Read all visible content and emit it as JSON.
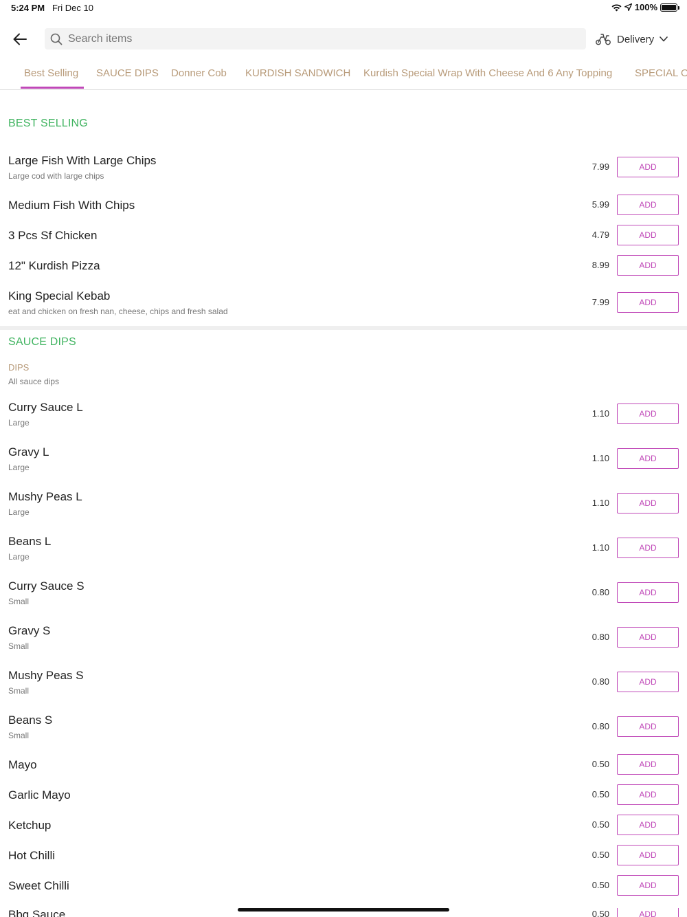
{
  "status_bar": {
    "time": "5:24 PM",
    "date": "Fri Dec 10",
    "battery": "100%"
  },
  "header": {
    "search_placeholder": "Search items",
    "delivery_label": "Delivery"
  },
  "tabs": [
    {
      "label": "Best Selling"
    },
    {
      "label": "SAUCE DIPS"
    },
    {
      "label": "Donner Cob"
    },
    {
      "label": "KURDISH SANDWICH"
    },
    {
      "label": "Kurdish Special Wrap With Cheese And 6 Any Topping"
    },
    {
      "label": "SPECIAL O"
    }
  ],
  "sections": {
    "best_selling": {
      "title": "BEST SELLING",
      "items": [
        {
          "name": "Large Fish With Large Chips",
          "desc": "Large cod with large chips",
          "price": "7.99",
          "button": "ADD"
        },
        {
          "name": "Medium Fish With Chips",
          "desc": "",
          "price": "5.99",
          "button": "ADD"
        },
        {
          "name": "3 Pcs Sf Chicken",
          "desc": "",
          "price": "4.79",
          "button": "ADD"
        },
        {
          "name": "12\" Kurdish Pizza",
          "desc": "",
          "price": "8.99",
          "button": "ADD"
        },
        {
          "name": "King Special Kebab",
          "desc": "eat and chicken on fresh nan, cheese, chips and fresh salad",
          "price": "7.99",
          "button": "ADD"
        }
      ]
    },
    "sauce_dips": {
      "title": "SAUCE DIPS",
      "sub_heading": "DIPS",
      "sub_desc": "All sauce dips",
      "items": [
        {
          "name": "Curry Sauce L",
          "desc": "Large",
          "price": "1.10",
          "button": "ADD"
        },
        {
          "name": "Gravy L",
          "desc": "Large",
          "price": "1.10",
          "button": "ADD"
        },
        {
          "name": "Mushy Peas L",
          "desc": "Large",
          "price": "1.10",
          "button": "ADD"
        },
        {
          "name": "Beans L",
          "desc": "Large",
          "price": "1.10",
          "button": "ADD"
        },
        {
          "name": "Curry Sauce S",
          "desc": "Small",
          "price": "0.80",
          "button": "ADD"
        },
        {
          "name": "Gravy S",
          "desc": "Small",
          "price": "0.80",
          "button": "ADD"
        },
        {
          "name": "Mushy Peas S",
          "desc": "Small",
          "price": "0.80",
          "button": "ADD"
        },
        {
          "name": "Beans S",
          "desc": "Small",
          "price": "0.80",
          "button": "ADD"
        },
        {
          "name": "Mayo",
          "desc": "",
          "price": "0.50",
          "button": "ADD"
        },
        {
          "name": "Garlic Mayo",
          "desc": "",
          "price": "0.50",
          "button": "ADD"
        },
        {
          "name": "Ketchup",
          "desc": "",
          "price": "0.50",
          "button": "ADD"
        },
        {
          "name": "Hot Chilli",
          "desc": "",
          "price": "0.50",
          "button": "ADD"
        },
        {
          "name": "Sweet Chilli",
          "desc": "",
          "price": "0.50",
          "button": "ADD"
        },
        {
          "name": "Bbq Sauce",
          "desc": "",
          "price": "0.50",
          "button": "ADD"
        }
      ]
    }
  },
  "colors": {
    "accent": "#c048b8",
    "section_title": "#3fb35f",
    "tab_text": "#b89b7a"
  }
}
